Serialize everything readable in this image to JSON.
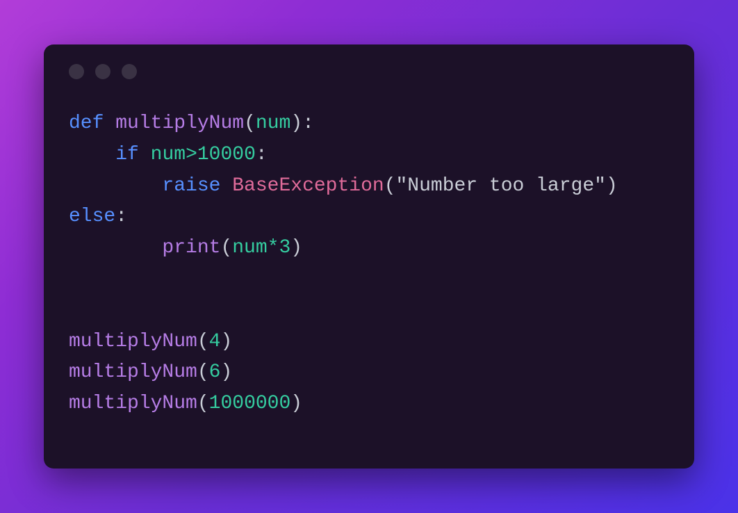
{
  "colors": {
    "bg_start": "#b23dd8",
    "bg_end": "#4a32e8",
    "window": "#1c1128",
    "dot": "#3a3244",
    "keyword": "#5790ff",
    "function": "#b67de6",
    "class": "#e06b9a",
    "value": "#35cda0",
    "default": "#c9cdd6"
  },
  "syntax": {
    "def": "def",
    "if": "if",
    "raise": "raise",
    "else": "else"
  },
  "code": {
    "fn_name": "multiplyNum",
    "param": "num",
    "threshold": "10000",
    "exc_class": "BaseException",
    "exc_msg_open": "\"Number too large\")",
    "print": "print",
    "mult_factor": "3",
    "calls": [
      {
        "arg": "4"
      },
      {
        "arg": "6"
      },
      {
        "arg": "1000000"
      }
    ]
  },
  "punct": {
    "lparen": "(",
    "rparen": ")",
    "colon": ":",
    "gt": ">",
    "star": "*"
  }
}
